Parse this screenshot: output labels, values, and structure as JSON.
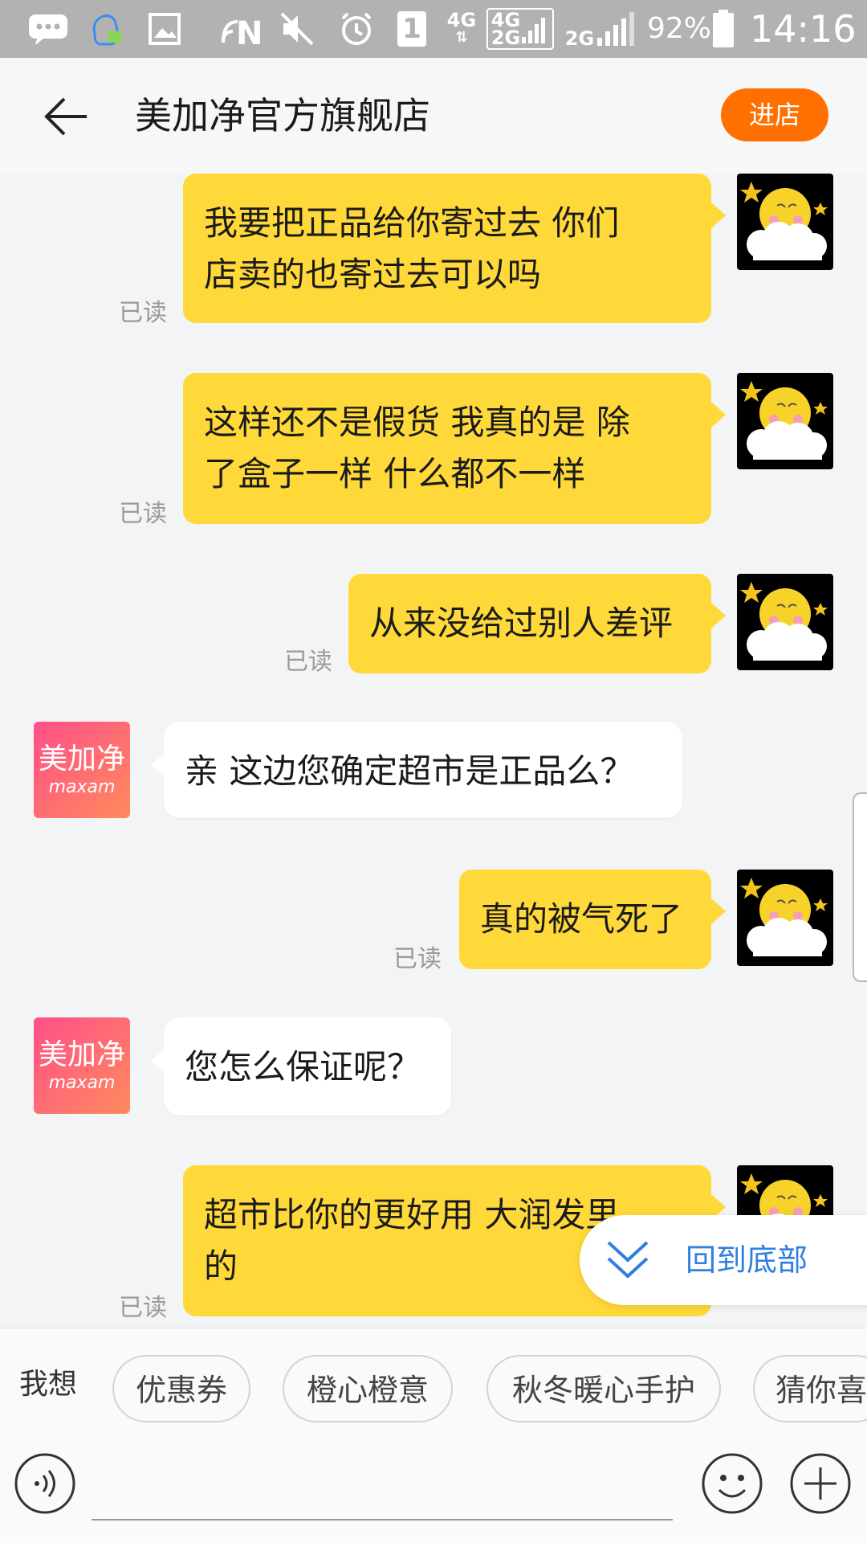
{
  "status_bar": {
    "network_4g": "4G",
    "network_4g_2g_top": "4G",
    "network_4g_2g_bottom": "2G",
    "network_2g": "2G",
    "sim_slot": "1",
    "battery": "92%",
    "time": "14:16"
  },
  "nav": {
    "title": "美加净官方旗舰店",
    "store_button": "进店"
  },
  "messages": [
    {
      "from": "me",
      "text": "我要把正品给你寄过去  你们\n店卖的也寄过去可以吗",
      "read": "已读"
    },
    {
      "from": "me",
      "text": "这样还不是假货  我真的是  除\n了盒子一样  什么都不一样",
      "read": "已读"
    },
    {
      "from": "me",
      "text": "从来没给过别人差评",
      "read": "已读"
    },
    {
      "from": "shop",
      "text": "亲 这边您确定超市是正品么？"
    },
    {
      "from": "me",
      "text": "真的被气死了",
      "read": "已读"
    },
    {
      "from": "shop",
      "text": "您怎么保证呢？"
    },
    {
      "from": "me",
      "text": "超市比你的更好用  大润发里\n的",
      "read": "已读"
    }
  ],
  "shop_avatar": {
    "cn": "美加净",
    "en": "maxam"
  },
  "back_to_bottom": "回到底部",
  "quick_replies": {
    "label": "我想",
    "chips": [
      "优惠券",
      "橙心橙意",
      "秋冬暖心手护",
      "猜你喜"
    ]
  },
  "input": {
    "placeholder": ""
  },
  "colors": {
    "status_bar": "#b2b2b2",
    "my_bubble": "#ffd93a",
    "store_button": "#ff7000",
    "link_blue": "#2f7fe0"
  }
}
